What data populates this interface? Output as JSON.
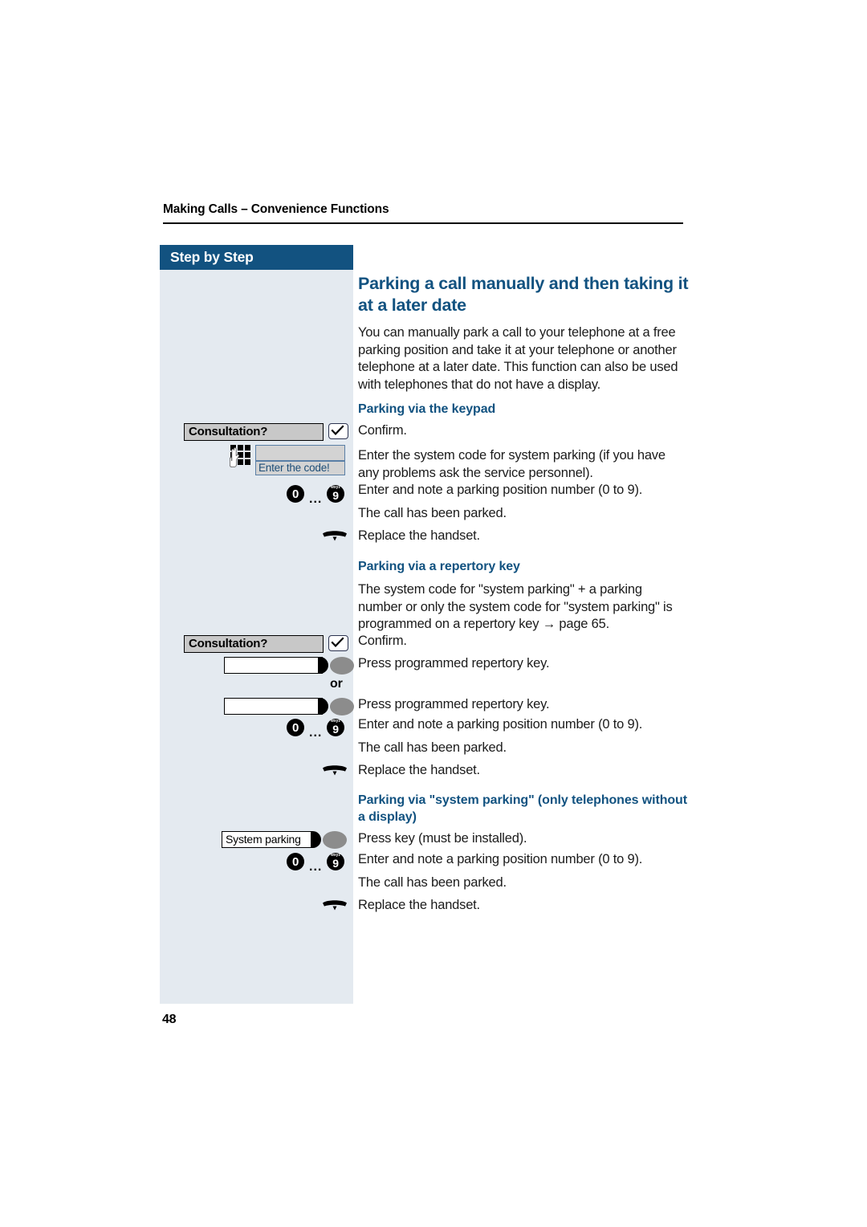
{
  "page": {
    "running_header": "Making Calls – Convenience Functions",
    "number": "48"
  },
  "sidebar": {
    "title": "Step by Step"
  },
  "main": {
    "title": "Parking a call manually and then taking it at a later date",
    "intro": "You can manually park a call to your telephone at a free parking position and take it at your telephone or another telephone at a later date. This function can also be used with telephones that do not have a display.",
    "sections": [
      {
        "heading": "Parking via the keypad",
        "steps": [
          "Confirm.",
          "Enter the system code for system parking (if you have any problems ask the service personnel).",
          "Enter and note a parking position number (0 to 9).",
          "The call has been parked.",
          "Replace the handset."
        ]
      },
      {
        "heading": "Parking via a repertory key",
        "steps": [
          "The system code for \"system parking\" + a parking number or only the system code for \"system parking\" is programmed on a repertory key → page 65.",
          "Confirm.",
          "Press programmed repertory key.",
          "Press programmed repertory key.",
          "Enter and note a parking position number (0 to 9).",
          "The call has been parked.",
          "Replace the handset."
        ]
      },
      {
        "heading": "Parking via \"system parking\" (only telephones without a display)",
        "steps": [
          "Press key (must be installed).",
          "Enter and note a parking position number (0 to 9).",
          "The call has been parked.",
          "Replace the handset."
        ]
      }
    ],
    "or_label": "or"
  },
  "widgets": {
    "softkey_consultation_1": "Consultation?",
    "softkey_consultation_2": "Consultation?",
    "display_prompt": "Enter the code!",
    "display_line_blank": "",
    "digit_zero": "0",
    "digit_nine": "9",
    "digit_nine_letters": "wxyz",
    "range_ellipsis": "...",
    "repertory_key_1_label": "",
    "repertory_key_2_label": "",
    "system_parking_key_label": "System parking"
  },
  "colors": {
    "accent_blue": "#125280",
    "sidebar_bg": "#e4eaf0",
    "display_gray": "#d3d3d3",
    "softkey_gray": "#c8c8c8",
    "oval_gray": "#8c8c8c"
  }
}
